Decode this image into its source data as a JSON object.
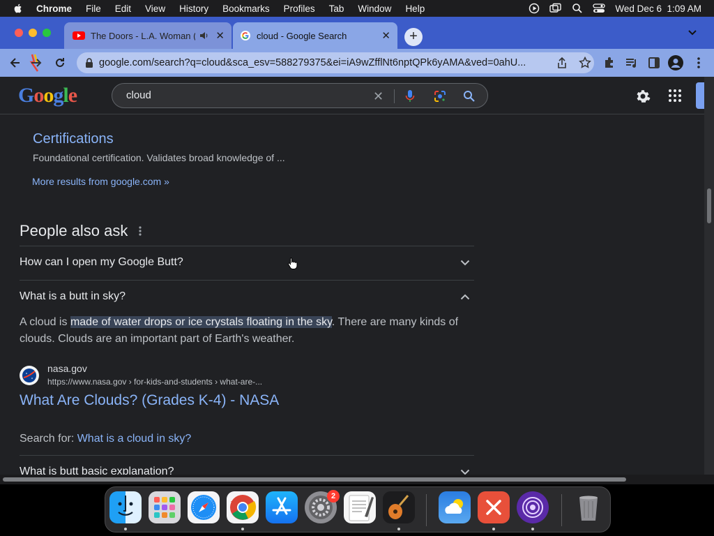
{
  "menubar": {
    "app_name": "Chrome",
    "items": [
      "File",
      "Edit",
      "View",
      "History",
      "Bookmarks",
      "Profiles",
      "Tab",
      "Window",
      "Help"
    ],
    "datetime": "Wed Dec 6  1:09 AM"
  },
  "tabs": [
    {
      "title": "The Doors - L.A. Woman (",
      "favicon": "youtube-icon",
      "audio": true
    },
    {
      "title": "cloud - Google Search",
      "favicon": "google-icon",
      "active": true
    }
  ],
  "toolbar": {
    "url": "google.com/search?q=cloud&sca_esv=588279375&ei=iA9wZfflNt6nptQPk6yAMA&ved=0ahU..."
  },
  "search": {
    "logo": "Google",
    "query": "cloud"
  },
  "results": {
    "sitelink_title": "Certifications",
    "sitelink_desc": "Foundational certification. Validates broad knowledge of ...",
    "more_results": "More results from google.com »"
  },
  "paa": {
    "title": "People also ask",
    "questions": [
      "How can I open my Google Butt?",
      "What is a butt in sky?",
      "What is butt basic explanation?"
    ],
    "answer": {
      "prefix": "A cloud is ",
      "highlight": "made of water drops or ice crystals floating in the sky",
      "suffix": ". There are many kinds of clouds. Clouds are an important part of Earth's weather."
    },
    "source": {
      "site": "nasa.gov",
      "url": "https://www.nasa.gov › for-kids-and-students › what-are-...",
      "title": "What Are Clouds? (Grades K-4) - NASA"
    },
    "search_for_label": "Search for: ",
    "search_for_link": "What is a cloud in sky?"
  },
  "dock": {
    "apps": [
      "Finder",
      "Launchpad",
      "Safari",
      "Chrome",
      "App Store",
      "System Settings",
      "TextEdit",
      "GarageBand",
      "Weather",
      "Remote Desktop",
      "Tor Browser",
      "Trash"
    ],
    "settings_badge": "2"
  }
}
